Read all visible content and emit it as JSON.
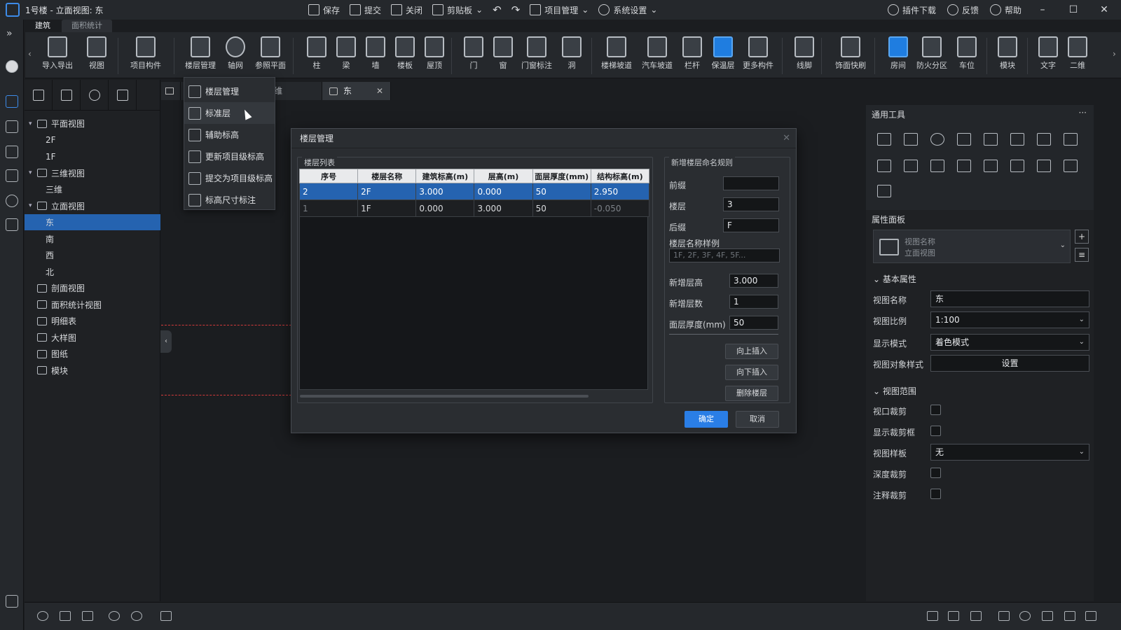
{
  "window": {
    "title": "1号楼 - 立面视图: 东",
    "toolbar": [
      "保存",
      "提交",
      "关闭",
      "剪贴板",
      "项目管理",
      "系统设置"
    ],
    "right_items": [
      "插件下载",
      "反馈",
      "帮助"
    ]
  },
  "ribbon_tabs": [
    "建筑",
    "面积统计"
  ],
  "ribbon": [
    "导入导出",
    "视图",
    "项目构件",
    "楼层管理",
    "轴网",
    "参照平面",
    "柱",
    "梁",
    "墙",
    "楼板",
    "屋顶",
    "门",
    "窗",
    "门窗标注",
    "洞",
    "楼梯坡道",
    "汽车坡道",
    "栏杆",
    "保温层",
    "更多构件",
    "线脚",
    "饰面快刷",
    "房间",
    "防火分区",
    "车位",
    "模块",
    "文字",
    "二维"
  ],
  "tree": [
    {
      "label": "平面视图",
      "level": 0,
      "expanded": true
    },
    {
      "label": "2F",
      "level": 1
    },
    {
      "label": "1F",
      "level": 1
    },
    {
      "label": "三维视图",
      "level": 0,
      "expanded": true
    },
    {
      "label": "三维",
      "level": 1
    },
    {
      "label": "立面视图",
      "level": 0,
      "expanded": true
    },
    {
      "label": "东",
      "level": 1,
      "selected": true
    },
    {
      "label": "南",
      "level": 1
    },
    {
      "label": "西",
      "level": 1
    },
    {
      "label": "北",
      "level": 1
    },
    {
      "label": "剖面视图",
      "level": 0
    },
    {
      "label": "面积统计视图",
      "level": 0
    },
    {
      "label": "明细表",
      "level": 0
    },
    {
      "label": "大样图",
      "level": 0
    },
    {
      "label": "图纸",
      "level": 0
    },
    {
      "label": "模块",
      "level": 0
    }
  ],
  "doc_tabs": [
    "维",
    "东"
  ],
  "dropdown": [
    "楼层管理",
    "标准层",
    "辅助标高",
    "更新项目级标高",
    "提交为项目级标高",
    "标高尺寸标注"
  ],
  "dialog": {
    "title": "楼层管理",
    "list_title": "楼层列表",
    "columns": [
      "序号",
      "楼层名称",
      "建筑标高(m)",
      "层高(m)",
      "面层厚度(mm)",
      "结构标高(m)"
    ],
    "rows": [
      [
        "2",
        "2F",
        "3.000",
        "0.000",
        "50",
        "2.950"
      ],
      [
        "1",
        "1F",
        "0.000",
        "3.000",
        "50",
        "-0.050"
      ]
    ],
    "rule_title": "新增楼层命名规则",
    "prefix_label": "前缀",
    "prefix_value": "",
    "floor_label": "楼层",
    "floor_value": "3",
    "suffix_label": "后缀",
    "suffix_value": "F",
    "sample_label": "楼层名称样例",
    "sample_value": "1F, 2F, 3F, 4F, 5F...",
    "new_height_label": "新增层高",
    "new_height_value": "3.000",
    "new_count_label": "新增层数",
    "new_count_value": "1",
    "thickness_label": "面层厚度(mm)",
    "thickness_value": "50",
    "insert_up": "向上插入",
    "insert_down": "向下插入",
    "delete_floor": "删除楼层",
    "ok": "确定",
    "cancel": "取消"
  },
  "right": {
    "tools_title": "通用工具",
    "props_title": "属性面板",
    "type_name": "视图名称",
    "type_sub": "立面视图",
    "basic_title": "基本属性",
    "range_title": "视图范围",
    "props": [
      {
        "label": "视图名称",
        "value": "东"
      },
      {
        "label": "视图比例",
        "value": "1:100"
      },
      {
        "label": "显示模式",
        "value": "着色模式"
      },
      {
        "label": "视图对象样式",
        "value": "设置"
      }
    ],
    "range": [
      {
        "label": "视口裁剪"
      },
      {
        "label": "显示裁剪框"
      },
      {
        "label": "视图样板",
        "value": "无"
      },
      {
        "label": "深度裁剪"
      },
      {
        "label": "注释裁剪"
      }
    ]
  },
  "colors": {
    "accent": "#2563b0",
    "primary_button": "#2a7ee6",
    "redline": "#d13a3a"
  }
}
